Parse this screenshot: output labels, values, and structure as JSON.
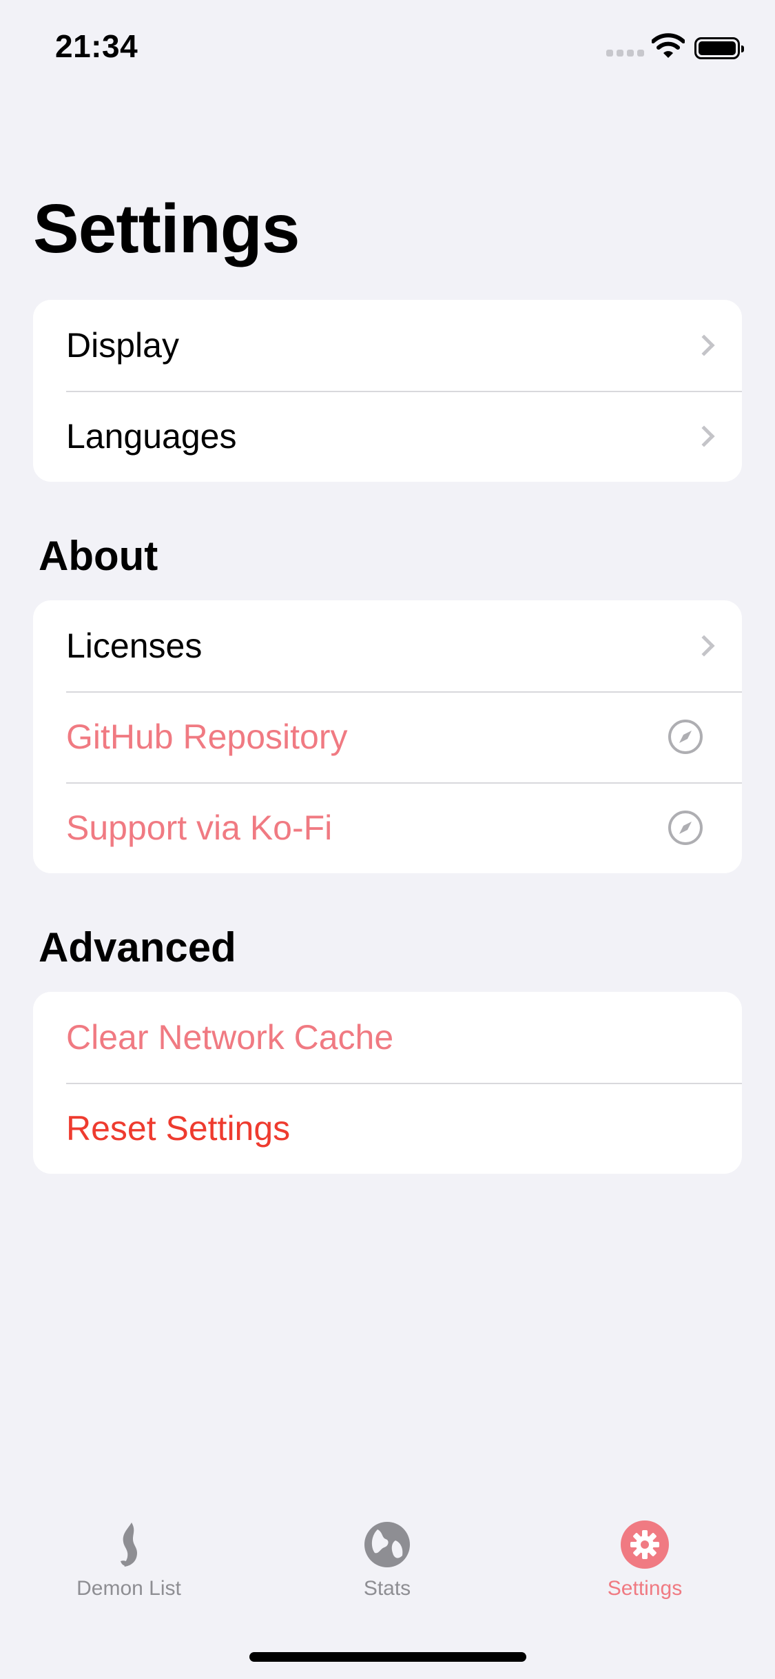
{
  "status_bar": {
    "time": "21:34"
  },
  "title": "Settings",
  "groups": {
    "general": {
      "items": [
        "Display",
        "Languages"
      ]
    },
    "about": {
      "header": "About",
      "items": [
        "Licenses",
        "GitHub Repository",
        "Support via Ko-Fi"
      ]
    },
    "advanced": {
      "header": "Advanced",
      "items": [
        "Clear Network Cache",
        "Reset Settings"
      ]
    }
  },
  "tabs": [
    "Demon List",
    "Stats",
    "Settings"
  ],
  "colors": {
    "accent": "#f07a82",
    "destructive": "#ee3b2f",
    "background": "#f2f2f7"
  }
}
